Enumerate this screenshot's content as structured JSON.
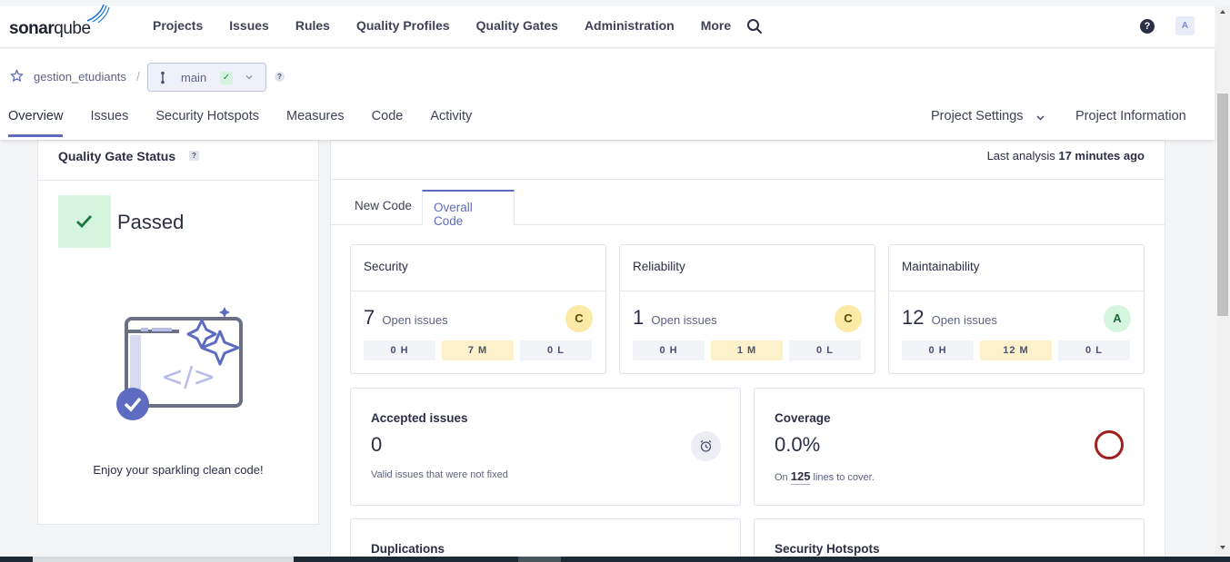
{
  "header": {
    "logo_text_a": "sonar",
    "logo_text_b": "qube",
    "nav": [
      "Projects",
      "Issues",
      "Rules",
      "Quality Profiles",
      "Quality Gates",
      "Administration",
      "More"
    ],
    "help_label": "?",
    "avatar_label": "A"
  },
  "project": {
    "name": "gestion_etudiants",
    "separator": "/",
    "branch": "main",
    "branch_status_glyph": "✓",
    "help_label": "?",
    "tabs": [
      "Overview",
      "Issues",
      "Security Hotspots",
      "Measures",
      "Code",
      "Activity"
    ],
    "active_tab": "Overview",
    "settings_label": "Project Settings",
    "info_label": "Project Information"
  },
  "quality_gate": {
    "title": "Quality Gate Status",
    "help_label": "?",
    "status": "Passed",
    "message": "Enjoy your sparkling clean code!"
  },
  "analysis": {
    "prefix": "Last analysis",
    "time": "17 minutes ago"
  },
  "code_tabs": {
    "new_code": "New Code",
    "overall_code": "Overall Code",
    "active": "Overall Code"
  },
  "metrics": [
    {
      "title": "Security",
      "count": "7",
      "label": "Open issues",
      "grade": "C",
      "sev_h": "0 H",
      "sev_m": "7 M",
      "sev_l": "0 L"
    },
    {
      "title": "Reliability",
      "count": "1",
      "label": "Open issues",
      "grade": "C",
      "sev_h": "0 H",
      "sev_m": "1 M",
      "sev_l": "0 L"
    },
    {
      "title": "Maintainability",
      "count": "12",
      "label": "Open issues",
      "grade": "A",
      "sev_h": "0 H",
      "sev_m": "12 M",
      "sev_l": "0 L"
    }
  ],
  "accepted": {
    "title": "Accepted issues",
    "value": "0",
    "sub": "Valid issues that were not fixed"
  },
  "coverage": {
    "title": "Coverage",
    "value": "0.0%",
    "sub_prefix": "On",
    "lines": "125",
    "sub_suffix": "lines to cover."
  },
  "duplications": {
    "title": "Duplications"
  },
  "hotspots": {
    "title": "Security Hotspots"
  },
  "colors": {
    "accent": "#5d6cc0",
    "passed_bg": "#d6f5df",
    "grade_c": "#fbe9a6",
    "grade_a": "#d6f5df",
    "coverage_ring": "#a02020"
  }
}
